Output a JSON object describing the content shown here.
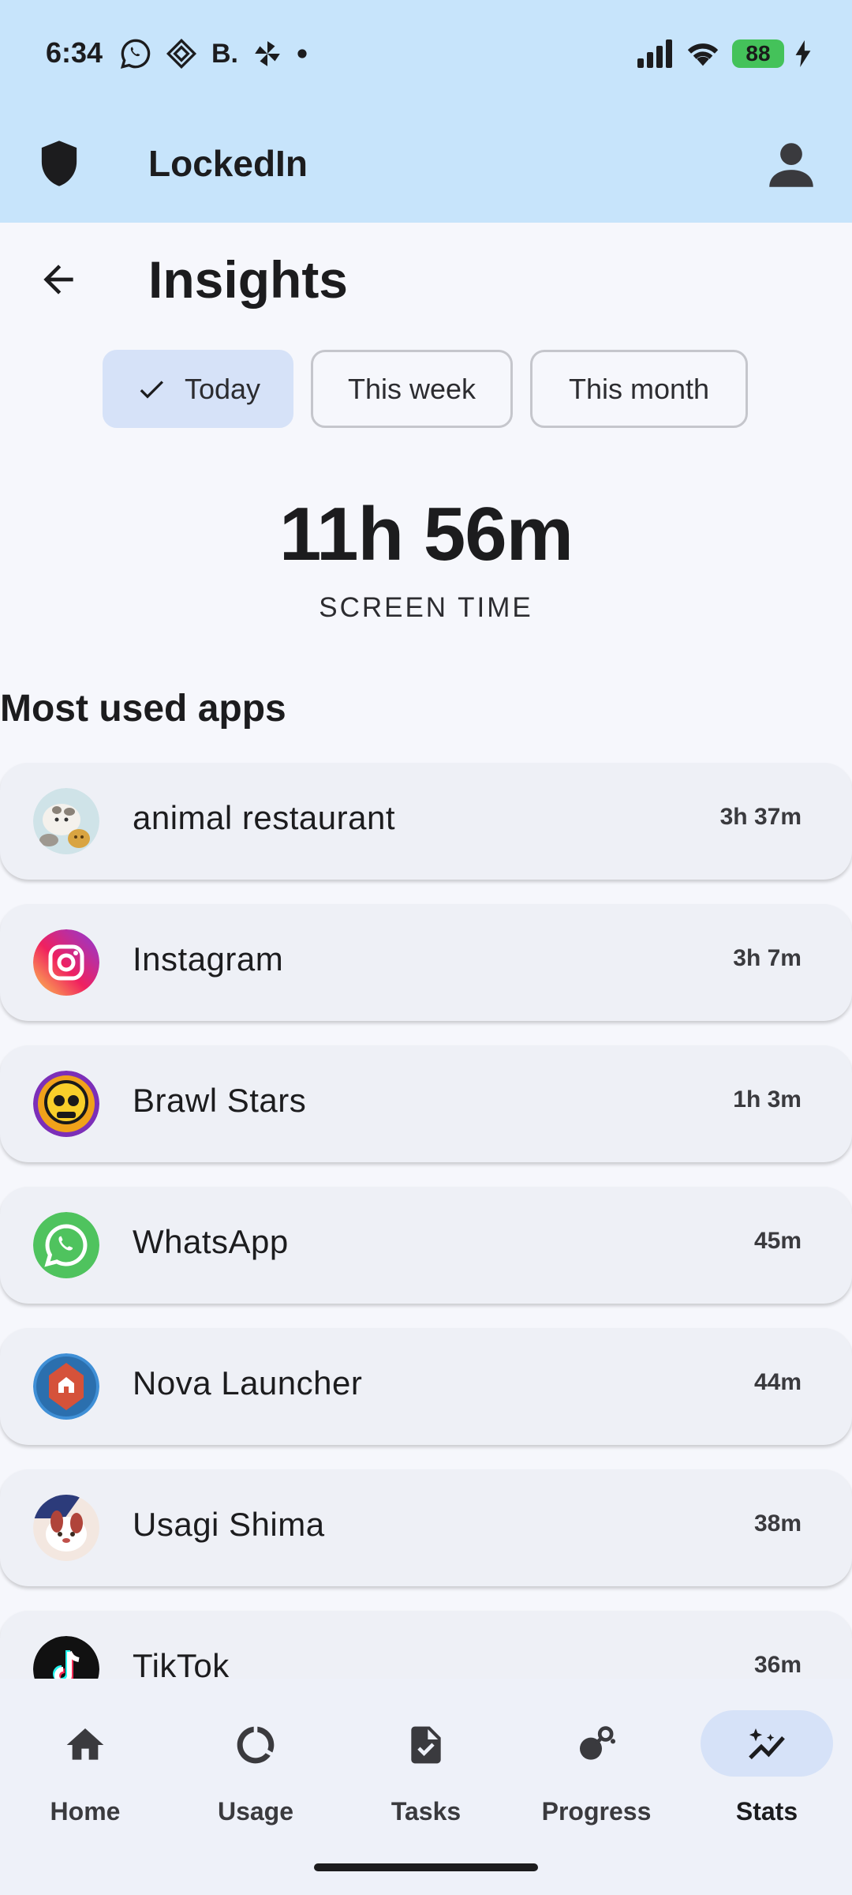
{
  "status_bar": {
    "time": "6:34",
    "battery": "88",
    "left_icons": [
      "whatsapp-icon",
      "proton-vpn-icon",
      "booking-icon",
      "pinwheel-icon",
      "dot-icon"
    ],
    "booking_text": "B."
  },
  "app_bar": {
    "title": "LockedIn"
  },
  "header": {
    "title": "Insights"
  },
  "filters": {
    "today": "Today",
    "week": "This week",
    "month": "This month",
    "selected": "Today"
  },
  "summary": {
    "screen_time": "11h 56m",
    "label": "SCREEN TIME"
  },
  "section": {
    "title": "Most used apps"
  },
  "apps": [
    {
      "name": "animal restaurant",
      "duration": "3h 37m",
      "icon": "animal-restaurant-icon"
    },
    {
      "name": "Instagram",
      "duration": "3h 7m",
      "icon": "instagram-icon"
    },
    {
      "name": "Brawl Stars",
      "duration": "1h 3m",
      "icon": "brawl-stars-icon"
    },
    {
      "name": "WhatsApp",
      "duration": "45m",
      "icon": "whatsapp-icon"
    },
    {
      "name": "Nova Launcher",
      "duration": "44m",
      "icon": "nova-launcher-icon"
    },
    {
      "name": "Usagi Shima",
      "duration": "38m",
      "icon": "usagi-shima-icon"
    },
    {
      "name": "TikTok",
      "duration": "36m",
      "icon": "tiktok-icon"
    }
  ],
  "nav": {
    "home": "Home",
    "usage": "Usage",
    "tasks": "Tasks",
    "progress": "Progress",
    "stats": "Stats",
    "active": "Stats"
  },
  "colors": {
    "app_bar_bg": "#c7e4fb",
    "page_bg": "#f6f7fc",
    "selected_chip": "#d6e2f8",
    "card_bg": "#eef0f6"
  }
}
